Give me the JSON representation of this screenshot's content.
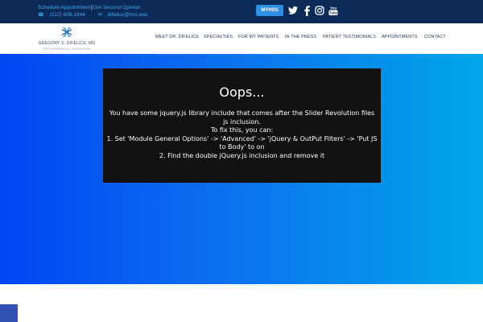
{
  "topbar": {
    "schedule_link": "Schedule Appointment",
    "separator": "|",
    "second_opinion_link": "Get Second Opinion",
    "phone": "(212) 606-1844",
    "email": "difelice@hss.edu",
    "myhss_label": "MYHSS",
    "social_icons": [
      "twitter-icon",
      "facebook-icon",
      "instagram-icon",
      "youtube-icon"
    ],
    "youtube_text": "You Tube"
  },
  "header": {
    "logo_name": "GREGORY S. DIFELICE, MD",
    "logo_subtitle": "ORTHOPAEDIC SURGEON",
    "nav": [
      "MEET DR. DIFELICE",
      "SPECIALTIES",
      "FOR MY PATIENTS",
      "IN THE PRESS",
      "PATIENT TESTIMONIALS",
      "APPOINTMENTS",
      "CONTACT"
    ]
  },
  "error": {
    "title": "Oops...",
    "line1": "You have some jquery.js library include that comes after the Slider Revolution files js inclusion.",
    "line2": "To fix this, you can:",
    "line3": "1. Set 'Module General Options' -> 'Advanced' -> 'jQuery & OutPut Filters' -> 'Put JS to Body' to on",
    "line4": "2. Find the double jQuery.js inclusion and remove it"
  },
  "colors": {
    "topbar": "#0b2a57",
    "link": "#3fa6ef",
    "myhss_button": "#2e8fe6",
    "hero_start": "#0046f2",
    "hero_end": "#00a6e8",
    "error_box": "#111111"
  }
}
